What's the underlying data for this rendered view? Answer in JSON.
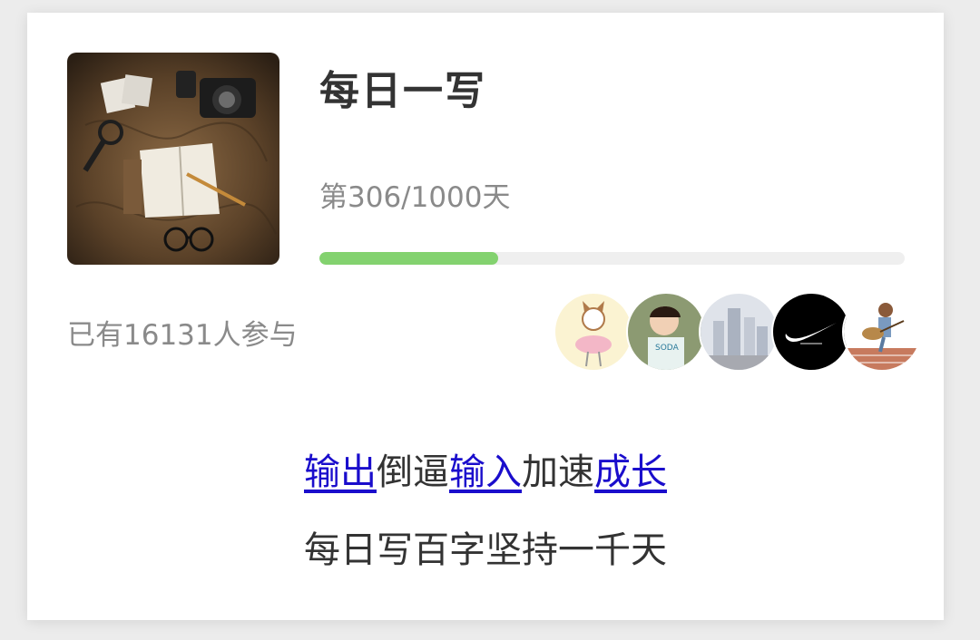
{
  "card": {
    "title": "每日一写",
    "progress_text": "第306/1000天",
    "progress": {
      "current": 306,
      "total": 1000,
      "fill_fraction": 0.306
    },
    "participants_text": "已有16131人参与",
    "colors": {
      "progress_fill": "#83d26f",
      "progress_track": "#efefef",
      "link": "#1a0dcc"
    }
  },
  "cover_image": {
    "description_icon": "journal-camera-map-icon"
  },
  "avatars": [
    {
      "icon": "cartoon-cat-ballerina-avatar"
    },
    {
      "icon": "child-soda-shirt-avatar"
    },
    {
      "icon": "city-buildings-avatar"
    },
    {
      "icon": "swoosh-logo-avatar"
    },
    {
      "icon": "girl-guitar-illustration-avatar"
    }
  ],
  "slogan": {
    "line1": {
      "link1": "输出",
      "text1": "倒逼",
      "link2": "输入",
      "text2": "加速",
      "link3": "成长"
    },
    "line2": "每日写百字坚持一千天"
  }
}
